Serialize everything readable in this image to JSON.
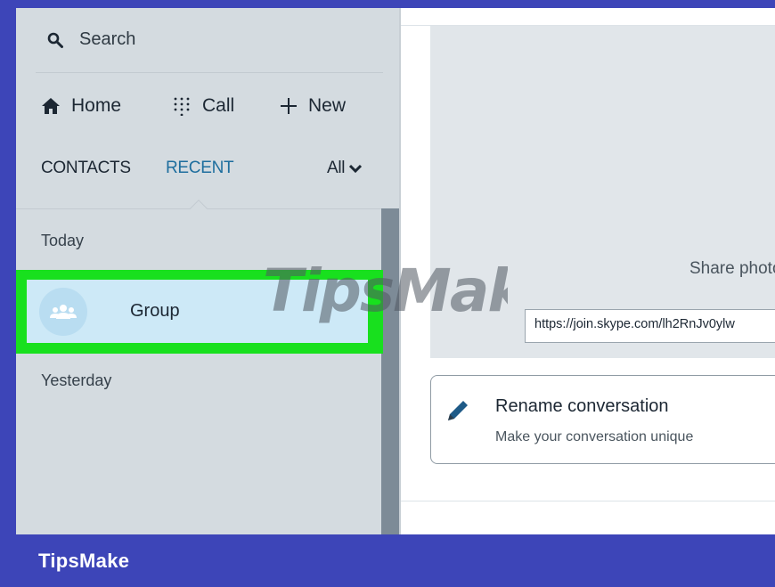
{
  "sidebar": {
    "search_label": "Search",
    "nav": {
      "home": "Home",
      "call": "Call",
      "new": "New"
    },
    "tabs": {
      "contacts": "CONTACTS",
      "recent": "RECENT",
      "filter": "All"
    },
    "sections": {
      "today": "Today",
      "yesterday": "Yesterday"
    },
    "conversations": [
      {
        "name": "Group",
        "selected": true
      }
    ]
  },
  "main": {
    "share_text": "Share photos",
    "link_value": "https://join.skype.com/lh2RnJv0ylw",
    "rename_card": {
      "title": "Rename conversation",
      "subtitle": "Make your conversation unique"
    }
  },
  "watermark": "TipsMake",
  "brand": "TipsMake",
  "colors": {
    "frame": "#3d45b8",
    "highlight": "#18e01e",
    "selected_row": "#cde9f7",
    "sidebar_bg": "#d4dbe0",
    "accent_tab": "#1e6e9e"
  }
}
